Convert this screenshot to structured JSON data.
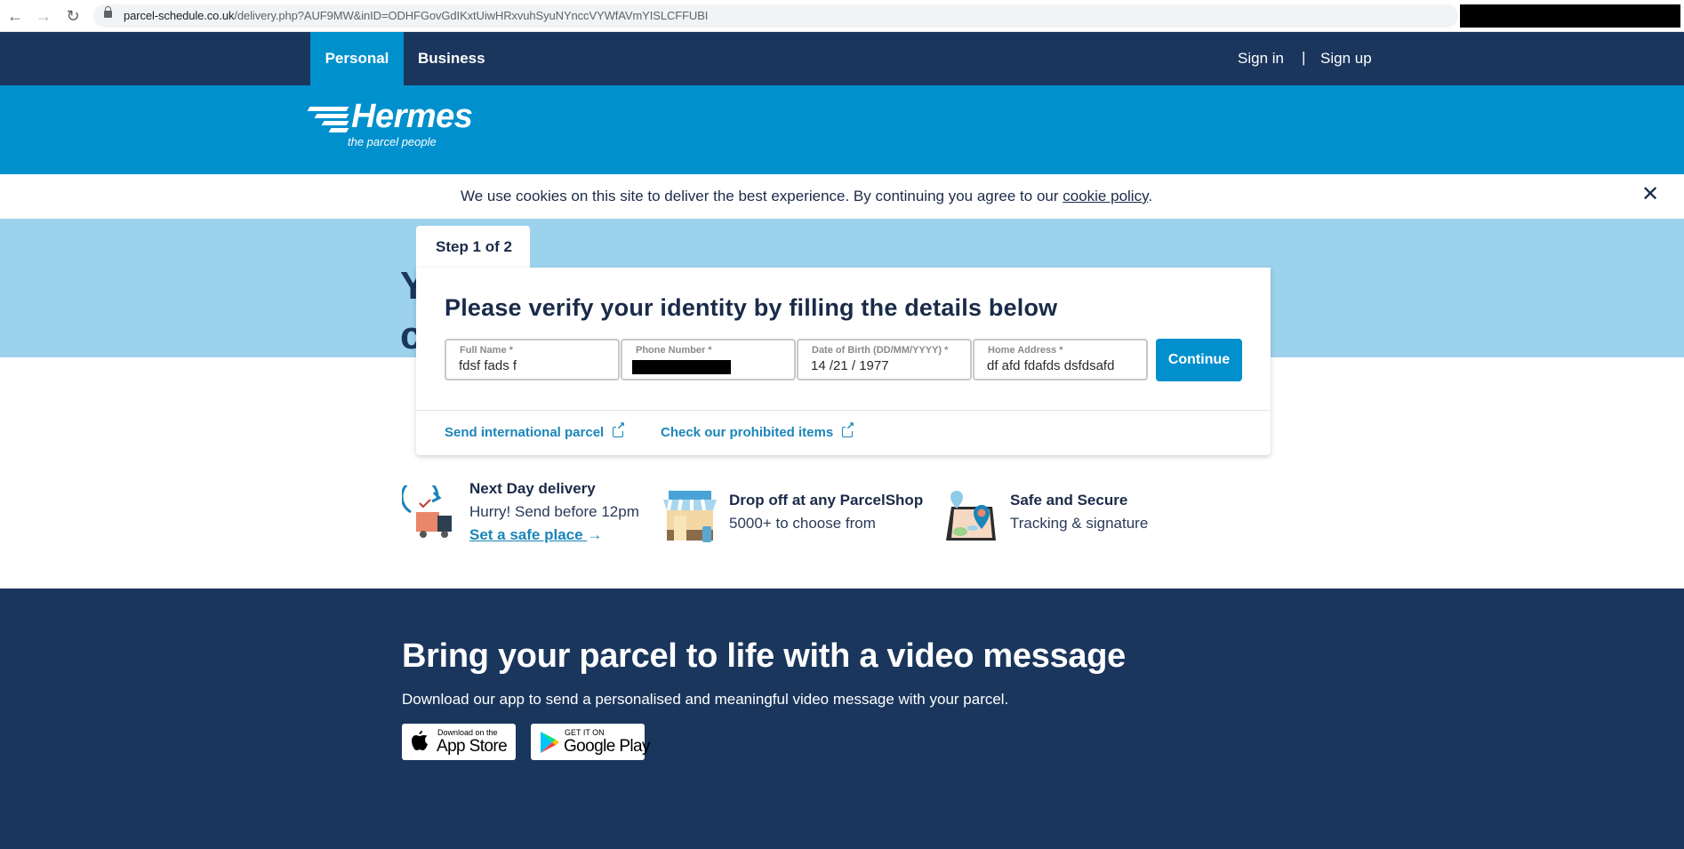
{
  "browser": {
    "url_domain": "parcel-schedule.co.uk",
    "url_path": "/delivery.php?AUF9MW&inID=ODHFGovGdIKxtUiwHRxvuhSyuNYnccVYWfAVmYISLCFFUBI",
    "back_icon": "arrow-left",
    "forward_icon": "arrow-right",
    "reload_icon": "reload"
  },
  "nav": {
    "tabs": [
      {
        "label": "Personal",
        "active": true
      },
      {
        "label": "Business",
        "active": false
      }
    ],
    "sign_in": "Sign in",
    "separator": "|",
    "sign_up": "Sign up"
  },
  "brand": {
    "name": "Hermes",
    "tagline": "the parcel people"
  },
  "cookie": {
    "text": "We use cookies on this site to deliver the best experience. By continuing you agree to our ",
    "link": "cookie policy",
    "end": ".",
    "close_icon": "close"
  },
  "hero": {
    "hidden_heading": "Y c"
  },
  "form": {
    "step": "Step 1 of 2",
    "title": "Please verify your identity by filling the details below",
    "fields": [
      {
        "label": "Full Name *",
        "value": "fdsf fads f"
      },
      {
        "label": "Phone Number *",
        "value": "",
        "redacted": true
      },
      {
        "label": "Date of Birth (DD/MM/YYYY) *",
        "value": "14 /21 / 1977"
      },
      {
        "label": "Home Address *",
        "value": "df afd fdafds dsfdsafd"
      }
    ],
    "continue_label": "Continue",
    "links": [
      {
        "label": "Send international parcel",
        "icon": "external-link"
      },
      {
        "label": "Check our prohibited items",
        "icon": "external-link"
      }
    ]
  },
  "features": [
    {
      "title": "Next Day delivery",
      "subtitle": "Hurry! Send before 12pm",
      "link": "Set a safe place",
      "link_arrow": "→",
      "icon": "delivery-van"
    },
    {
      "title": "Drop off at any ParcelShop",
      "subtitle": "5000+ to choose from",
      "icon": "parcel-shop"
    },
    {
      "title": "Safe and Secure",
      "subtitle": "Tracking & signature",
      "icon": "map-pin"
    }
  ],
  "promo": {
    "title": "Bring your parcel to life with a video message",
    "subtitle": "Download our app to send a personalised and meaningful video message with your parcel.",
    "app_store": {
      "small": "Download on the",
      "big": "App Store"
    },
    "google_play": {
      "small": "GET IT ON",
      "big": "Google Play"
    }
  },
  "colors": {
    "navy": "#1a365d",
    "brand_blue": "#0090cd",
    "light_blue": "#9dd2ec",
    "link_blue": "#1a85b8"
  }
}
